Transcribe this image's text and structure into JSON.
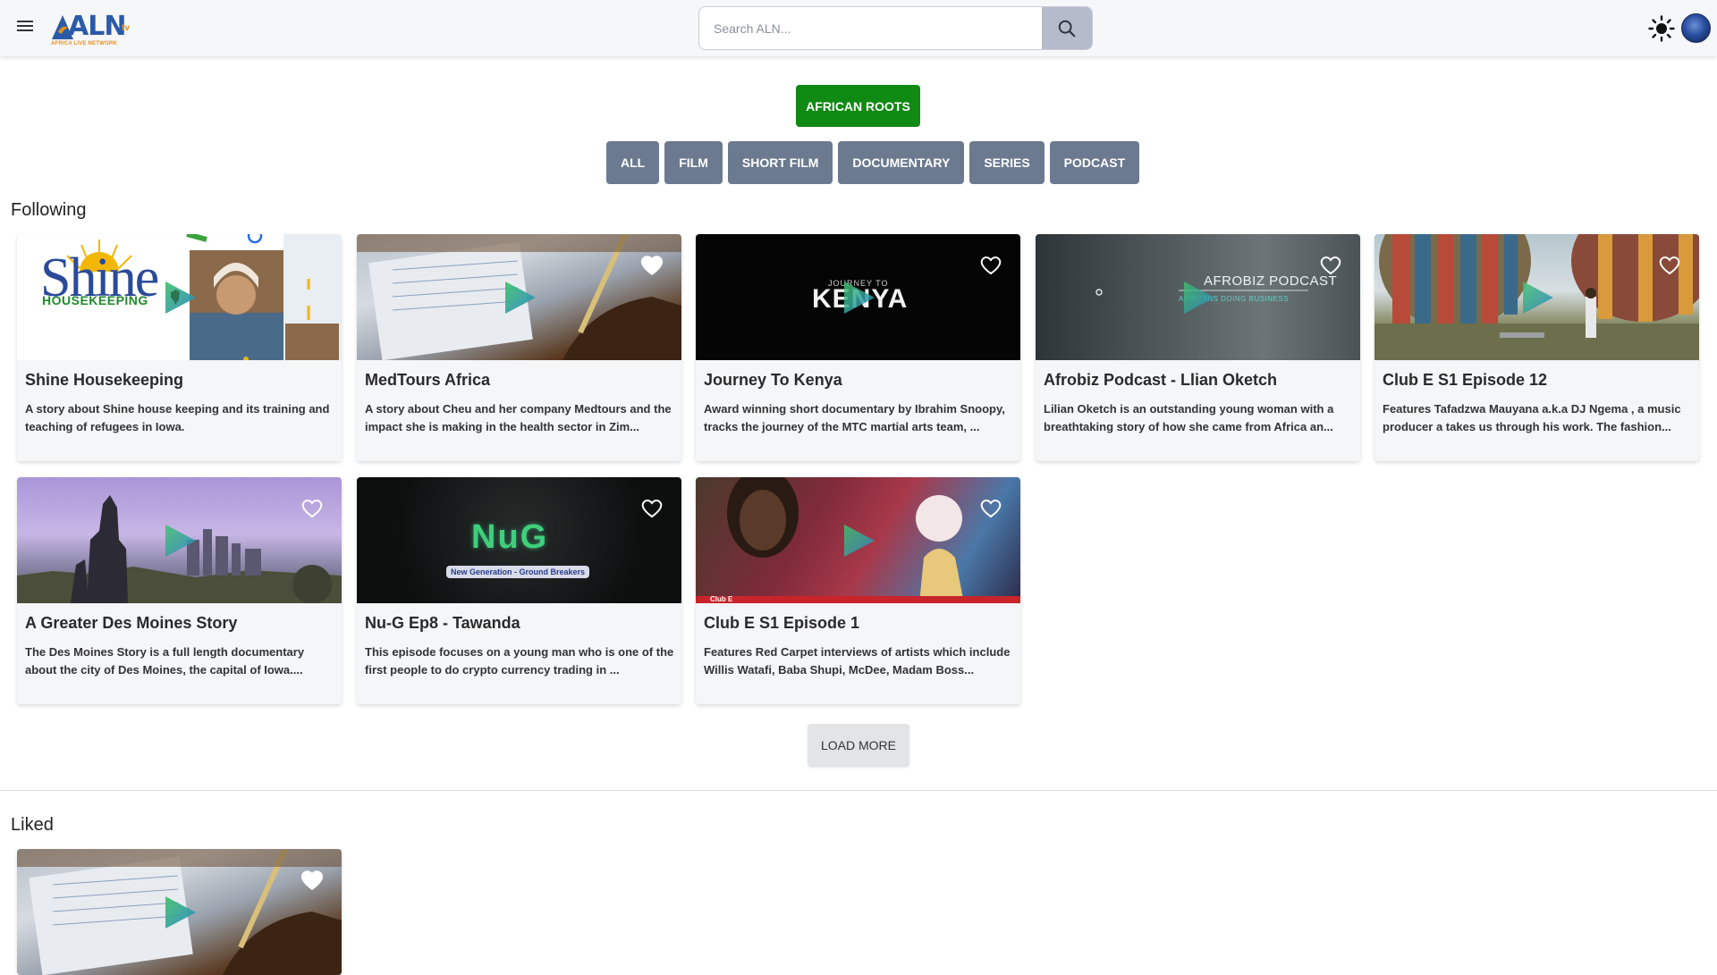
{
  "header": {
    "logo_text": "ALN",
    "logo_tld": "tv",
    "logo_tagline": "AFRICA LIVE NETWORK",
    "search_placeholder": "Search ALN...",
    "icons": {
      "menu": "hamburger-icon",
      "search": "search-icon",
      "theme": "sun-icon",
      "avatar": "avatar"
    }
  },
  "filters": {
    "featured": "AFRICAN ROOTS",
    "featured_color": "#0f8a12",
    "categories": [
      "ALL",
      "FILM",
      "SHORT FILM",
      "DOCUMENTARY",
      "SERIES",
      "PODCAST"
    ],
    "category_color": "#6c7a90"
  },
  "following": {
    "title": "Following",
    "items": [
      {
        "title": "Shine Housekeeping",
        "description": "A story about Shine house keeping and its training and teaching of refugees in Iowa.",
        "thumb_text": "Shine",
        "thumb_subtext": "HOUSEKEEPING"
      },
      {
        "title": "MedTours Africa",
        "description": "A story about Cheu and her company Medtours and the impact she is making in the health sector in Zim..."
      },
      {
        "title": "Journey To Kenya",
        "description": "Award winning short documentary by Ibrahim Snoopy, tracks the journey of the MTC martial arts team, ...",
        "thumb_text": "KENYA",
        "thumb_subtext": "JOURNEY TO"
      },
      {
        "title": "Afrobiz Podcast - Llian Oketch",
        "description": "Lilian Oketch is an outstanding young woman with a breathtaking story of how she came from Africa an...",
        "thumb_text": "AFROBIZ PODCAST",
        "thumb_subtext": "AFRICANS DOING BUSINESS"
      },
      {
        "title": "Club E S1 Episode 12",
        "description": "Features Tafadzwa Mauyana a.k.a DJ Ngema , a music producer a takes us through his work. The fashion..."
      },
      {
        "title": "A Greater Des Moines Story",
        "description": "The Des Moines Story is a full length documentary about the city of Des Moines, the capital of Iowa...."
      },
      {
        "title": "Nu-G Ep8 - Tawanda",
        "description": "This episode focuses on a young man who is one of the first people to do crypto currency trading in ...",
        "thumb_text": "NuG",
        "thumb_subtext": "New Generation - Ground Breakers"
      },
      {
        "title": "Club E S1 Episode 1",
        "description": "Features Red Carpet interviews of artists which include Willis Watafi, Baba Shupi, McDee, Madam Boss...",
        "thumb_subtext": "Club E"
      }
    ],
    "load_more": "LOAD MORE"
  },
  "liked": {
    "title": "Liked"
  }
}
